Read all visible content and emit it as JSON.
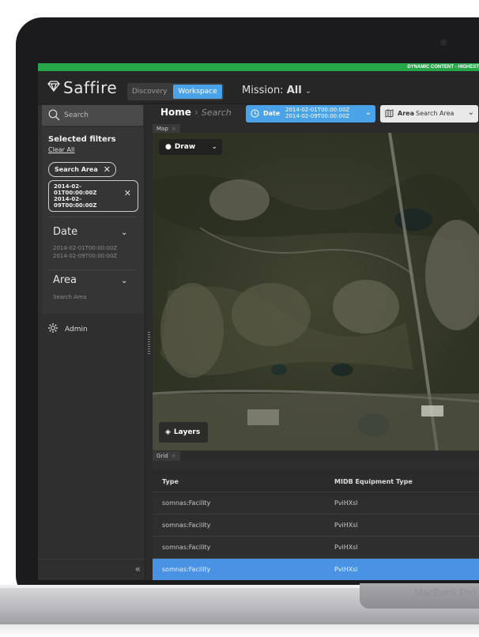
{
  "laptop": {
    "brand": "MacBook Pro"
  },
  "banner": {
    "text": "DYNAMIC CONTENT - HIGHEST"
  },
  "topbar": {
    "logo": "Saffire",
    "tabs": [
      {
        "label": "Discovery"
      },
      {
        "label": "Workspace"
      }
    ],
    "mission_label": "Mission:",
    "mission_value": "All"
  },
  "sidebar": {
    "search_label": "Search",
    "selected_filters_title": "Selected filters",
    "clear_all": "Clear All",
    "chips": [
      {
        "label": "Search Area"
      },
      {
        "label": "2014-02-01T00:00:00Z 2014-02-09T00:00:00Z",
        "lines": [
          "2014-02-",
          "01T00:00:00Z",
          "2014-02-",
          "09T00:00:00Z"
        ]
      }
    ],
    "facets": [
      {
        "title": "Date",
        "values": [
          "2014-02-01T00:00:00Z",
          "2014-02-09T00:00:00Z"
        ]
      },
      {
        "title": "Area",
        "values": [
          "Search Area"
        ]
      }
    ],
    "admin": "Admin",
    "collapse": "«"
  },
  "main": {
    "breadcrumb": {
      "home": "Home",
      "current": "Search"
    },
    "date_pill": {
      "label": "Date",
      "from": "2014-02-01T00:00:00Z",
      "to": "2014-02-09T00:00:00Z"
    },
    "area_pill": {
      "label": "Area",
      "value": "Search Area"
    },
    "map_tab": "Map",
    "draw": "Draw",
    "layers": "Layers",
    "grid_tab": "Grid",
    "grid": {
      "columns": [
        "Type",
        "MIDB Equipment Type"
      ],
      "rows": [
        [
          "somnas:Facility",
          "PviHXsl"
        ],
        [
          "somnas:Facility",
          "PviHXsl"
        ],
        [
          "somnas:Facility",
          "PviHXsl"
        ],
        [
          "somnas:Facility",
          "PviHXsl"
        ]
      ]
    }
  },
  "colors": {
    "accent": "#4aa3e8",
    "banner": "#27a74a",
    "selected_row": "#4a92e3"
  }
}
